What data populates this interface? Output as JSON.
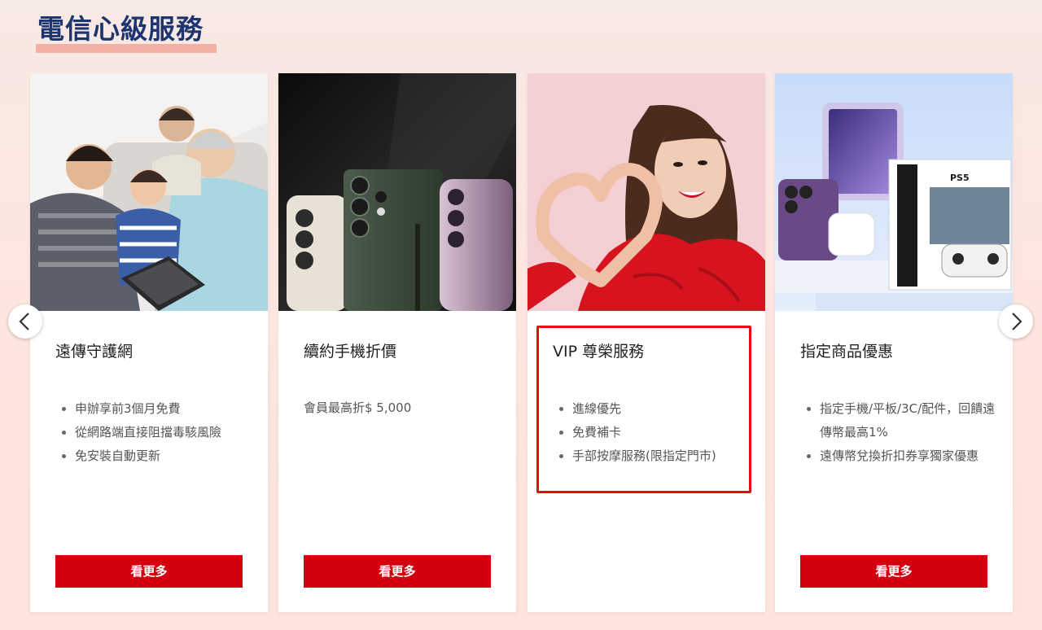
{
  "section": {
    "title": "電信心級服務"
  },
  "cards": [
    {
      "title": "遠傳守護網",
      "bullets": [
        "申辦享前3個月免費",
        "從網路端直接阻擋毒駭風險",
        "免安裝自動更新"
      ],
      "button_label": "看更多",
      "image": "family-with-tablet-photo"
    },
    {
      "title": "續約手機折價",
      "text": "會員最高折$ 5,000",
      "button_label": "看更多",
      "image": "smartphones-photo"
    },
    {
      "title": "VIP 尊榮服務",
      "bullets": [
        "進線優先",
        "免費補卡",
        "手部按摩服務(限指定門市)"
      ],
      "image": "woman-heart-hands-photo",
      "highlighted": true
    },
    {
      "title": "指定商品優惠",
      "bullets": [
        "指定手機/平板/3C/配件，回饋遠傳幣最高1%",
        "遠傳幣兌換折扣券享獨家優惠"
      ],
      "button_label": "看更多",
      "image": "devices-and-console-photo"
    }
  ],
  "carousel": {
    "prev_icon": "chevron-left-icon",
    "next_icon": "chevron-right-icon"
  },
  "colors": {
    "title": "#1c3470",
    "underline": "#f4b0a4",
    "button": "#d4000f",
    "highlight": "#e01010"
  }
}
